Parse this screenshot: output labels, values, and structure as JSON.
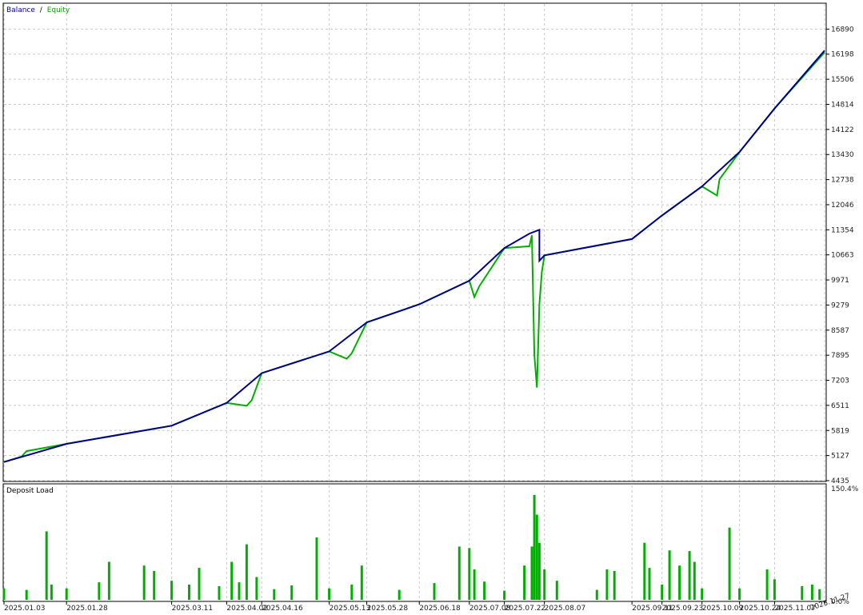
{
  "chart_data": [
    {
      "type": "line",
      "panel": "equity",
      "title": "",
      "legend": {
        "placement": "top-left",
        "balance_label": "Balance",
        "separator": "/",
        "equity_label": "Equity"
      },
      "ylim": [
        4435,
        17582
      ],
      "yticks": [
        4435,
        5127,
        5819,
        6511,
        7203,
        7895,
        8587,
        9279,
        9971,
        10663,
        11354,
        12046,
        12738,
        13430,
        14122,
        14814,
        15506,
        16198,
        16890
      ],
      "ytick_labels": [
        "4435",
        "5127",
        "5819",
        "6511",
        "7203",
        "7895",
        "8587",
        "9279",
        "9971",
        "10663",
        "11354",
        "12046",
        "12738",
        "13430",
        "14122",
        "14814",
        "15506",
        "16198",
        "16890"
      ],
      "xlim": [
        "2025.01.03",
        "2025.11.27"
      ],
      "xtick_labels": [
        "2025.01.03",
        "2025.01.28",
        "2025.03.11",
        "2025.04.02",
        "2025.04.16",
        "2025.05.13",
        "2025.05.28",
        "2025.06.18",
        "2025.07.08",
        "2025.07.22",
        "2025.08.07",
        "2025.09.11",
        "2025.09.23",
        "2025.10.09",
        "2025.10.24",
        "2025.11.07",
        "2025.11.27"
      ],
      "grid": true,
      "series": [
        {
          "name": "Balance",
          "color": "#00008b",
          "x": [
            "2025.01.03",
            "2025.01.28",
            "2025.03.11",
            "2025.04.02",
            "2025.04.16",
            "2025.05.13",
            "2025.05.28",
            "2025.06.18",
            "2025.07.08",
            "2025.07.22",
            "2025.08.01",
            "2025.08.05",
            "2025.08.05",
            "2025.08.07",
            "2025.09.11",
            "2025.09.23",
            "2025.10.09",
            "2025.10.24",
            "2025.11.07",
            "2025.11.27"
          ],
          "values": [
            4950,
            5450,
            5950,
            6580,
            7400,
            8000,
            8800,
            9300,
            9950,
            10850,
            11250,
            11354,
            10500,
            10650,
            11100,
            11750,
            12550,
            13500,
            14700,
            16300
          ]
        },
        {
          "name": "Equity",
          "color": "#00b000",
          "x": [
            "2025.01.03",
            "2025.01.10",
            "2025.01.12",
            "2025.01.28",
            "2025.03.11",
            "2025.04.02",
            "2025.04.10",
            "2025.04.12",
            "2025.04.16",
            "2025.05.13",
            "2025.05.20",
            "2025.05.22",
            "2025.05.28",
            "2025.06.18",
            "2025.07.08",
            "2025.07.10",
            "2025.07.12",
            "2025.07.22",
            "2025.08.01",
            "2025.08.02",
            "2025.08.03",
            "2025.08.04",
            "2025.08.05",
            "2025.08.06",
            "2025.08.07",
            "2025.09.11",
            "2025.09.23",
            "2025.10.09",
            "2025.10.15",
            "2025.10.16",
            "2025.10.24",
            "2025.11.07",
            "2025.11.27"
          ],
          "values": [
            4950,
            5100,
            5250,
            5450,
            5950,
            6580,
            6500,
            6650,
            7400,
            8000,
            7800,
            7950,
            8800,
            9300,
            9950,
            9500,
            9800,
            10850,
            10900,
            11200,
            7900,
            7000,
            9300,
            10200,
            10650,
            11100,
            11750,
            12550,
            12300,
            12750,
            13500,
            14700,
            16250
          ]
        }
      ]
    },
    {
      "type": "bar",
      "panel": "deposit-load",
      "title": "Deposit Load",
      "ylim": [
        0,
        150.4
      ],
      "ytick_labels": [
        "0.0%",
        "150.4%"
      ],
      "ymax_label": "150.4%",
      "ymin_label": "0.0%",
      "color": "#00b000",
      "spikes": [
        {
          "x": "2025.01.03",
          "value": 15
        },
        {
          "x": "2025.01.12",
          "value": 13
        },
        {
          "x": "2025.01.20",
          "value": 90
        },
        {
          "x": "2025.01.22",
          "value": 20
        },
        {
          "x": "2025.01.28",
          "value": 15
        },
        {
          "x": "2025.02.10",
          "value": 23
        },
        {
          "x": "2025.02.14",
          "value": 50
        },
        {
          "x": "2025.02.28",
          "value": 45
        },
        {
          "x": "2025.03.04",
          "value": 38
        },
        {
          "x": "2025.03.11",
          "value": 25
        },
        {
          "x": "2025.03.18",
          "value": 20
        },
        {
          "x": "2025.03.22",
          "value": 42
        },
        {
          "x": "2025.03.30",
          "value": 18
        },
        {
          "x": "2025.04.04",
          "value": 50
        },
        {
          "x": "2025.04.07",
          "value": 23
        },
        {
          "x": "2025.04.10",
          "value": 73
        },
        {
          "x": "2025.04.14",
          "value": 30
        },
        {
          "x": "2025.04.21",
          "value": 14
        },
        {
          "x": "2025.04.28",
          "value": 19
        },
        {
          "x": "2025.05.08",
          "value": 82
        },
        {
          "x": "2025.05.13",
          "value": 15
        },
        {
          "x": "2025.05.22",
          "value": 20
        },
        {
          "x": "2025.05.26",
          "value": 45
        },
        {
          "x": "2025.06.10",
          "value": 13
        },
        {
          "x": "2025.06.24",
          "value": 22
        },
        {
          "x": "2025.07.04",
          "value": 70
        },
        {
          "x": "2025.07.08",
          "value": 68
        },
        {
          "x": "2025.07.10",
          "value": 40
        },
        {
          "x": "2025.07.14",
          "value": 24
        },
        {
          "x": "2025.07.22",
          "value": 12
        },
        {
          "x": "2025.07.30",
          "value": 45
        },
        {
          "x": "2025.08.02",
          "value": 70
        },
        {
          "x": "2025.08.03",
          "value": 138
        },
        {
          "x": "2025.08.04",
          "value": 112
        },
        {
          "x": "2025.08.05",
          "value": 75
        },
        {
          "x": "2025.08.07",
          "value": 40
        },
        {
          "x": "2025.08.12",
          "value": 25
        },
        {
          "x": "2025.08.28",
          "value": 13
        },
        {
          "x": "2025.09.01",
          "value": 40
        },
        {
          "x": "2025.09.04",
          "value": 38
        },
        {
          "x": "2025.09.16",
          "value": 75
        },
        {
          "x": "2025.09.18",
          "value": 42
        },
        {
          "x": "2025.09.23",
          "value": 20
        },
        {
          "x": "2025.09.26",
          "value": 65
        },
        {
          "x": "2025.09.30",
          "value": 45
        },
        {
          "x": "2025.10.04",
          "value": 64
        },
        {
          "x": "2025.10.06",
          "value": 50
        },
        {
          "x": "2025.10.09",
          "value": 15
        },
        {
          "x": "2025.10.20",
          "value": 95
        },
        {
          "x": "2025.10.24",
          "value": 15
        },
        {
          "x": "2025.11.04",
          "value": 40
        },
        {
          "x": "2025.11.07",
          "value": 27
        },
        {
          "x": "2025.11.18",
          "value": 18
        },
        {
          "x": "2025.11.22",
          "value": 20
        },
        {
          "x": "2025.11.25",
          "value": 14
        }
      ]
    }
  ]
}
